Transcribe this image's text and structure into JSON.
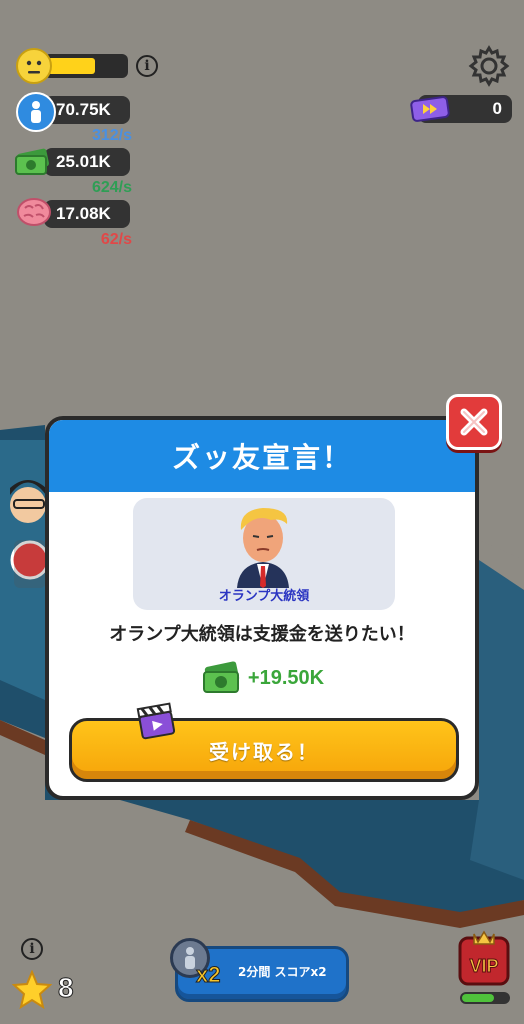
{
  "hud": {
    "mood_level": 0.62,
    "stats": [
      {
        "icon": "people-icon",
        "value": "70.75K",
        "rate": "312/s",
        "rate_color": "#4a90e2"
      },
      {
        "icon": "money-icon",
        "value": "25.01K",
        "rate": "624/s",
        "rate_color": "#2f9e55"
      },
      {
        "icon": "brain-icon",
        "value": "17.08K",
        "rate": "62/s",
        "rate_color": "#e04848"
      }
    ],
    "tickets": "0"
  },
  "dialog": {
    "title": "ズッ友宣言！",
    "character_name": "オランプ大統領",
    "message": "オランプ大統領は支援金を送りたい！",
    "reward": "+19.50K",
    "accept_label": "受け取る！"
  },
  "bottom": {
    "stars": "8",
    "boost_label": "2分間 スコアx2",
    "boost_multiplier": "x2",
    "vip_label": "VIP",
    "vip_progress": 0.7
  }
}
